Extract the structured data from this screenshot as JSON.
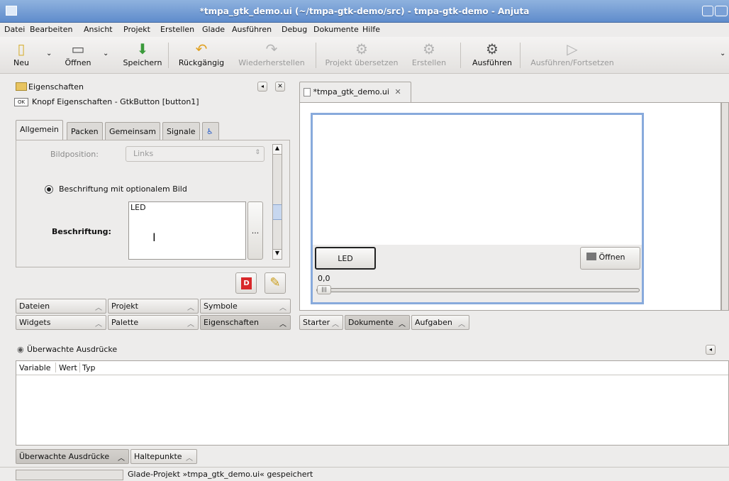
{
  "window": {
    "title": "*tmpa_gtk_demo.ui (~/tmpa-gtk-demo/src) - tmpa-gtk-demo - Anjuta"
  },
  "menu": [
    "Datei",
    "Bearbeiten",
    "Ansicht",
    "Projekt",
    "Erstellen",
    "Glade",
    "Ausführen",
    "Debug",
    "Dokumente",
    "Hilfe"
  ],
  "toolbar": {
    "new": "Neu",
    "open": "Öffnen",
    "save": "Speichern",
    "undo": "Rückgängig",
    "redo": "Wiederherstellen",
    "compile": "Projekt übersetzen",
    "build": "Erstellen",
    "run": "Ausführen",
    "continue": "Ausführen/Fortsetzen"
  },
  "props": {
    "title": "Eigenschaften",
    "widget_badge": "OK",
    "widget_label": "Knopf Eigenschaften - GtkButton [button1]",
    "tabs": [
      "Allgemein",
      "Packen",
      "Gemeinsam",
      "Signale"
    ],
    "image_position_label": "Bildposition:",
    "image_position_value": "Links",
    "radio_label": "Beschriftung mit optionalem Bild",
    "caption_label": "Beschriftung:",
    "caption_value": "LED",
    "more_button": "..."
  },
  "bottom_tabs_row1": [
    "Dateien",
    "Projekt",
    "Symbole"
  ],
  "bottom_tabs_row2": [
    "Widgets",
    "Palette",
    "Eigenschaften"
  ],
  "editor": {
    "tab_label": "*tmpa_gtk_demo.ui",
    "led_button": "LED",
    "open_button": "Öffnen",
    "value_label": "0,0"
  },
  "doc_tabs": [
    "Starter",
    "Dokumente",
    "Aufgaben"
  ],
  "watch": {
    "title": "Überwachte Ausdrücke",
    "columns": [
      "Variable",
      "Wert",
      "Typ"
    ]
  },
  "footer_tabs": [
    "Überwachte Ausdrücke",
    "Haltepunkte"
  ],
  "status": {
    "message": "Glade-Projekt »tmpa_gtk_demo.ui« gespeichert"
  }
}
